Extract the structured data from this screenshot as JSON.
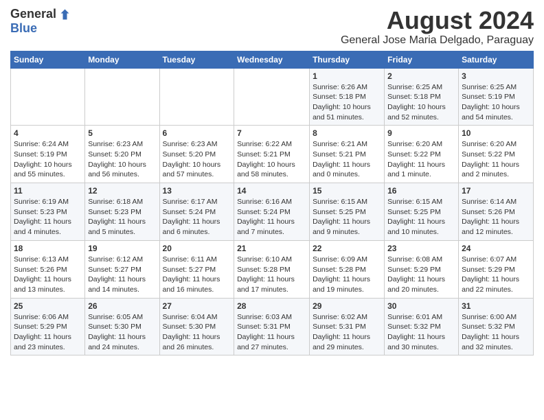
{
  "header": {
    "logo_general": "General",
    "logo_blue": "Blue",
    "title": "August 2024",
    "subtitle": "General Jose Maria Delgado, Paraguay"
  },
  "days_of_week": [
    "Sunday",
    "Monday",
    "Tuesday",
    "Wednesday",
    "Thursday",
    "Friday",
    "Saturday"
  ],
  "weeks": [
    [
      {
        "day": "",
        "info": ""
      },
      {
        "day": "",
        "info": ""
      },
      {
        "day": "",
        "info": ""
      },
      {
        "day": "",
        "info": ""
      },
      {
        "day": "1",
        "info": "Sunrise: 6:26 AM\nSunset: 5:18 PM\nDaylight: 10 hours and 51 minutes."
      },
      {
        "day": "2",
        "info": "Sunrise: 6:25 AM\nSunset: 5:18 PM\nDaylight: 10 hours and 52 minutes."
      },
      {
        "day": "3",
        "info": "Sunrise: 6:25 AM\nSunset: 5:19 PM\nDaylight: 10 hours and 54 minutes."
      }
    ],
    [
      {
        "day": "4",
        "info": "Sunrise: 6:24 AM\nSunset: 5:19 PM\nDaylight: 10 hours and 55 minutes."
      },
      {
        "day": "5",
        "info": "Sunrise: 6:23 AM\nSunset: 5:20 PM\nDaylight: 10 hours and 56 minutes."
      },
      {
        "day": "6",
        "info": "Sunrise: 6:23 AM\nSunset: 5:20 PM\nDaylight: 10 hours and 57 minutes."
      },
      {
        "day": "7",
        "info": "Sunrise: 6:22 AM\nSunset: 5:21 PM\nDaylight: 10 hours and 58 minutes."
      },
      {
        "day": "8",
        "info": "Sunrise: 6:21 AM\nSunset: 5:21 PM\nDaylight: 11 hours and 0 minutes."
      },
      {
        "day": "9",
        "info": "Sunrise: 6:20 AM\nSunset: 5:22 PM\nDaylight: 11 hours and 1 minute."
      },
      {
        "day": "10",
        "info": "Sunrise: 6:20 AM\nSunset: 5:22 PM\nDaylight: 11 hours and 2 minutes."
      }
    ],
    [
      {
        "day": "11",
        "info": "Sunrise: 6:19 AM\nSunset: 5:23 PM\nDaylight: 11 hours and 4 minutes."
      },
      {
        "day": "12",
        "info": "Sunrise: 6:18 AM\nSunset: 5:23 PM\nDaylight: 11 hours and 5 minutes."
      },
      {
        "day": "13",
        "info": "Sunrise: 6:17 AM\nSunset: 5:24 PM\nDaylight: 11 hours and 6 minutes."
      },
      {
        "day": "14",
        "info": "Sunrise: 6:16 AM\nSunset: 5:24 PM\nDaylight: 11 hours and 7 minutes."
      },
      {
        "day": "15",
        "info": "Sunrise: 6:15 AM\nSunset: 5:25 PM\nDaylight: 11 hours and 9 minutes."
      },
      {
        "day": "16",
        "info": "Sunrise: 6:15 AM\nSunset: 5:25 PM\nDaylight: 11 hours and 10 minutes."
      },
      {
        "day": "17",
        "info": "Sunrise: 6:14 AM\nSunset: 5:26 PM\nDaylight: 11 hours and 12 minutes."
      }
    ],
    [
      {
        "day": "18",
        "info": "Sunrise: 6:13 AM\nSunset: 5:26 PM\nDaylight: 11 hours and 13 minutes."
      },
      {
        "day": "19",
        "info": "Sunrise: 6:12 AM\nSunset: 5:27 PM\nDaylight: 11 hours and 14 minutes."
      },
      {
        "day": "20",
        "info": "Sunrise: 6:11 AM\nSunset: 5:27 PM\nDaylight: 11 hours and 16 minutes."
      },
      {
        "day": "21",
        "info": "Sunrise: 6:10 AM\nSunset: 5:28 PM\nDaylight: 11 hours and 17 minutes."
      },
      {
        "day": "22",
        "info": "Sunrise: 6:09 AM\nSunset: 5:28 PM\nDaylight: 11 hours and 19 minutes."
      },
      {
        "day": "23",
        "info": "Sunrise: 6:08 AM\nSunset: 5:29 PM\nDaylight: 11 hours and 20 minutes."
      },
      {
        "day": "24",
        "info": "Sunrise: 6:07 AM\nSunset: 5:29 PM\nDaylight: 11 hours and 22 minutes."
      }
    ],
    [
      {
        "day": "25",
        "info": "Sunrise: 6:06 AM\nSunset: 5:29 PM\nDaylight: 11 hours and 23 minutes."
      },
      {
        "day": "26",
        "info": "Sunrise: 6:05 AM\nSunset: 5:30 PM\nDaylight: 11 hours and 24 minutes."
      },
      {
        "day": "27",
        "info": "Sunrise: 6:04 AM\nSunset: 5:30 PM\nDaylight: 11 hours and 26 minutes."
      },
      {
        "day": "28",
        "info": "Sunrise: 6:03 AM\nSunset: 5:31 PM\nDaylight: 11 hours and 27 minutes."
      },
      {
        "day": "29",
        "info": "Sunrise: 6:02 AM\nSunset: 5:31 PM\nDaylight: 11 hours and 29 minutes."
      },
      {
        "day": "30",
        "info": "Sunrise: 6:01 AM\nSunset: 5:32 PM\nDaylight: 11 hours and 30 minutes."
      },
      {
        "day": "31",
        "info": "Sunrise: 6:00 AM\nSunset: 5:32 PM\nDaylight: 11 hours and 32 minutes."
      }
    ]
  ]
}
